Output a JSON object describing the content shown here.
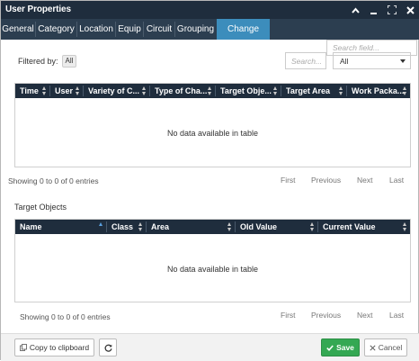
{
  "window": {
    "title": "User Properties"
  },
  "tabs": [
    {
      "label": "General"
    },
    {
      "label": "Category"
    },
    {
      "label": "Location"
    },
    {
      "label": "Equip"
    },
    {
      "label": "Circuit"
    },
    {
      "label": "Grouping"
    },
    {
      "label": "Change Logs",
      "active": true
    }
  ],
  "search": {
    "placeholder": "Search field..."
  },
  "filter": {
    "label": "Filtered by:",
    "value": "All"
  },
  "changelog": {
    "search_placeholder": "Search...",
    "select_value": "All",
    "columns": [
      "Time",
      "User",
      "Variety of C...",
      "Type of Cha...",
      "Target Obje...",
      "Target Area",
      "Work Packa..."
    ],
    "empty_text": "No data available in table",
    "info": "Showing 0 to 0 of 0 entries"
  },
  "pagination": {
    "first": "First",
    "previous": "Previous",
    "next": "Next",
    "last": "Last"
  },
  "target_objects": {
    "title": "Target Objects",
    "columns": [
      "Name",
      "Class",
      "Area",
      "Old Value",
      "Current Value"
    ],
    "empty_text": "No data available in table",
    "info": "Showing 0 to 0 of 0 entries"
  },
  "footer": {
    "copy_label": "Copy to clipboard",
    "save_label": "Save",
    "cancel_label": "Cancel"
  },
  "colors": {
    "titlebar": "#1f2d3d",
    "tabbar": "#2c3e50",
    "active_tab": "#3c8dbc",
    "save": "#34a853"
  },
  "icons": [
    "chevron-up-icon",
    "minimize-icon",
    "maximize-icon",
    "close-icon",
    "copy-icon",
    "refresh-icon",
    "check-icon",
    "x-icon",
    "sort-icon",
    "caret-down-icon"
  ]
}
